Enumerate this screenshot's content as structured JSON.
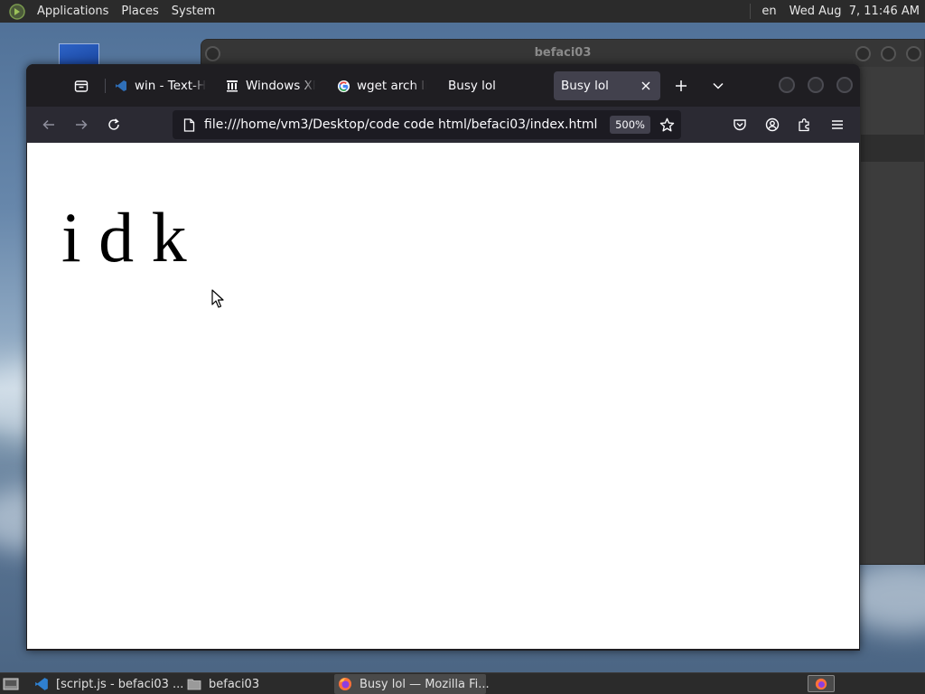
{
  "top_panel": {
    "menus": [
      "Applications",
      "Places",
      "System"
    ],
    "language": "en",
    "clock": "Wed Aug  7, 11:46 AM"
  },
  "background_window": {
    "title": "befaci03"
  },
  "browser": {
    "tabs": [
      {
        "label": "win - Text-H",
        "icon": "vscode-icon"
      },
      {
        "label": "Windows XP",
        "icon": "archive-icon"
      },
      {
        "label": "wget arch lin",
        "icon": "google-icon"
      },
      {
        "label": "Busy lol",
        "icon": "none"
      },
      {
        "label": "Busy lol",
        "icon": "none",
        "active": true
      }
    ],
    "url": "file:///home/vm3/Desktop/code code html/befaci03/index.html",
    "zoom": "500%",
    "page_text": "i d k"
  },
  "taskbar": {
    "items": [
      {
        "label": "[script.js - befaci03 ...",
        "icon": "vscode-icon"
      },
      {
        "label": "befaci03",
        "icon": "folder-icon"
      },
      {
        "label": "Busy lol — Mozilla Fi...",
        "icon": "firefox-icon",
        "active": true
      }
    ]
  },
  "colors": {
    "panel": "#2b2b2b",
    "tabbar": "#1f1e22",
    "navbar": "#2b2a33",
    "urlbar": "#1c1b22",
    "active_tab": "#42414d"
  }
}
